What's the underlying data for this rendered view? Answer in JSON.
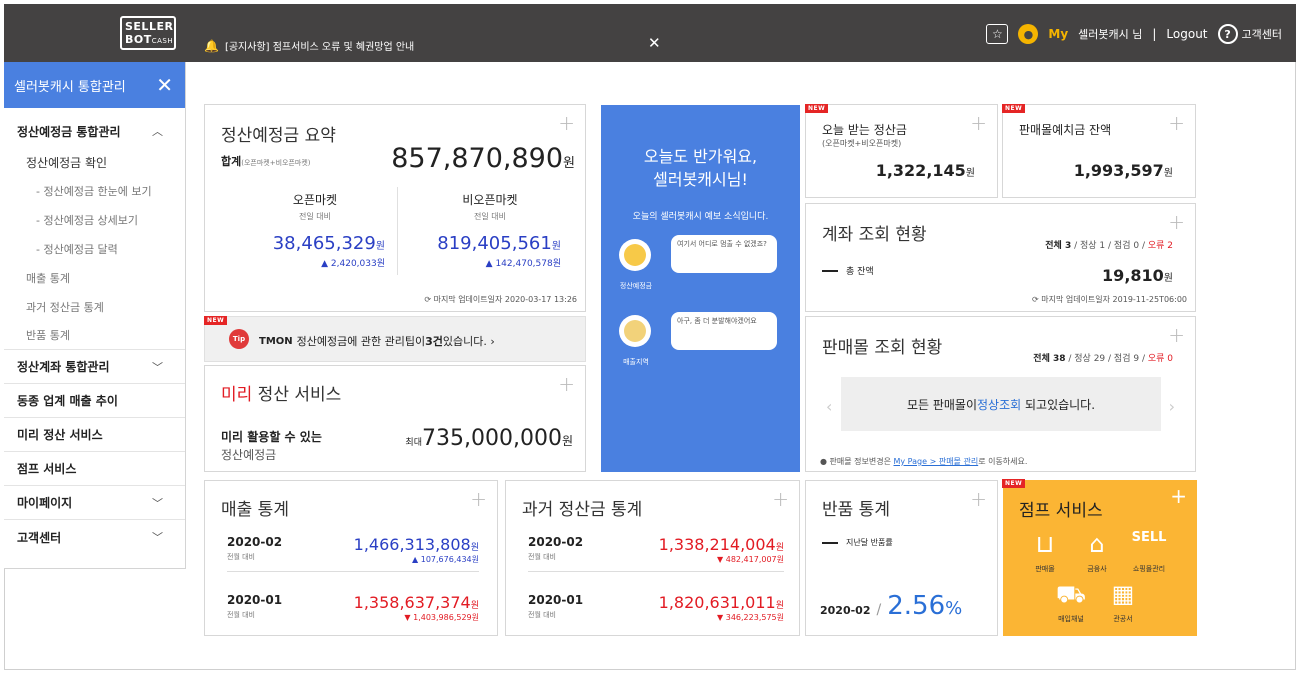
{
  "header": {
    "logo_line1": "SELLER",
    "logo_line2": "BOT",
    "logo_sub": "CASH",
    "notice": "[공지사항]  점프서비스 오류 및 혜권망업 안내",
    "my_label": "My",
    "user_text": "셀러봇캐시 님",
    "separator": "|",
    "logout": "Logout",
    "help": "고객센터"
  },
  "sidebar": {
    "title": "셀러봇캐시 통합관리",
    "section1": "정산예정금 통합관리",
    "sub_confirm": "정산예정금 확인",
    "sub_items": [
      "- 정산예정금 한눈에 보기",
      "- 정산예정금 상세보기",
      "- 정산예정금 달력"
    ],
    "gray_items": [
      "매출 통계",
      "과거 정산금 통계",
      "반품 통계"
    ],
    "items": [
      "정산계좌 통합관리",
      "동종 업계 매출 추이",
      "미리 정산 서비스",
      "점프 서비스",
      "마이페이지",
      "고객센터"
    ]
  },
  "summary": {
    "title": "정산예정금 요약",
    "total_label": "합계",
    "total_note": "(오픈마켓+비오픈마켓)",
    "total_value": "857,870,890",
    "won": "원",
    "open_label": "오픈마켓",
    "open_sub": "전일 대비",
    "open_value": "38,465,329",
    "open_change": "▲ 2,420,033원",
    "nonopen_label": "비오픈마켓",
    "nonopen_sub": "전일 대비",
    "nonopen_value": "819,405,561",
    "nonopen_change": "▲ 142,470,578원",
    "updated": "마지막 업데이트일자 2020-03-17 13:26"
  },
  "tip": {
    "new": "NEW",
    "badge": "Tip",
    "brand": "TMON",
    "text_before": "정산예정금에 관한 관리팁이 ",
    "count": "3건",
    "text_after": " 있습니다. ›"
  },
  "miri": {
    "title_red": "미리",
    "title_rest": " 정산 서비스",
    "line1": "미리 활용할 수 있는",
    "line2": "정산예정금",
    "max": "최대",
    "amount": "735,000,000",
    "won": "원"
  },
  "greeting": {
    "line1": "오늘도 반가워요,",
    "line2": "셀러봇캐시님!",
    "sub": "오늘의 셀러봇캐시 예보 소식입니다.",
    "bubble1": "여기서 어디로 멈출 수 없겠죠?",
    "label1": "정산예정금",
    "bubble2": "아구, 좀 더 분발해야겠어요",
    "label2": "매출지역"
  },
  "today": {
    "new": "NEW",
    "title": "오늘 받는 정산금",
    "sub": "(오픈마켓+비오픈마켓)",
    "value": "1,322,145",
    "won": "원"
  },
  "deposit": {
    "new": "NEW",
    "title": "판매몰예치금 잔액",
    "value": "1,993,597",
    "won": "원"
  },
  "account": {
    "title": "계좌 조회 현황",
    "stat_total": "전체 3",
    "stat_normal": "정상 1",
    "stat_check": "점검 0",
    "stat_error": "오류 2",
    "legend": "총 잔액",
    "value": "19,810",
    "won": "원",
    "updated": "마지막 업데이트일자 2019-11-25T06:00"
  },
  "mall": {
    "title": "판매몰 조회 현황",
    "stat_total": "전체 38",
    "stat_normal": "정상 29",
    "stat_check": "점검 9",
    "stat_error": "오류 0",
    "msg_before": "모든 판매몰이 ",
    "msg_link": "정상조회",
    "msg_after": " 되고있습니다.",
    "note_before": "판매몰 정보변경은 ",
    "note_link": "My Page > 판매몰 관리",
    "note_after": "로 이동하세요."
  },
  "sales": {
    "title": "매출 통계",
    "rows": [
      {
        "date": "2020-02",
        "sub": "전월 대비",
        "value": "1,466,313,808",
        "change": "▲ 107,676,434원"
      },
      {
        "date": "2020-01",
        "sub": "전월 대비",
        "value": "1,358,637,374",
        "change": "▼ 1,403,986,529원"
      }
    ],
    "won": "원"
  },
  "past": {
    "title": "과거 정산금 통계",
    "rows": [
      {
        "date": "2020-02",
        "sub": "전월 대비",
        "value": "1,338,214,004",
        "change": "▼ 482,417,007원"
      },
      {
        "date": "2020-01",
        "sub": "전월 대비",
        "value": "1,820,631,011",
        "change": "▼ 346,223,575원"
      }
    ],
    "won": "원"
  },
  "returns": {
    "title": "반품 통계",
    "legend": "지난달 반품률",
    "date": "2020-02",
    "slash": "/",
    "value": "2.56",
    "unit": "%"
  },
  "jump": {
    "new": "NEW",
    "title": "점프 서비스",
    "items": [
      "판매몰",
      "금융사",
      "쇼핑몰관리",
      "매입채널",
      "관공서"
    ]
  },
  "colors": {
    "topbar": "#444242",
    "accent_blue": "#4a80e0",
    "yellow": "#fbb534",
    "red": "#e21b23",
    "value_blue": "#2a3fc4"
  }
}
